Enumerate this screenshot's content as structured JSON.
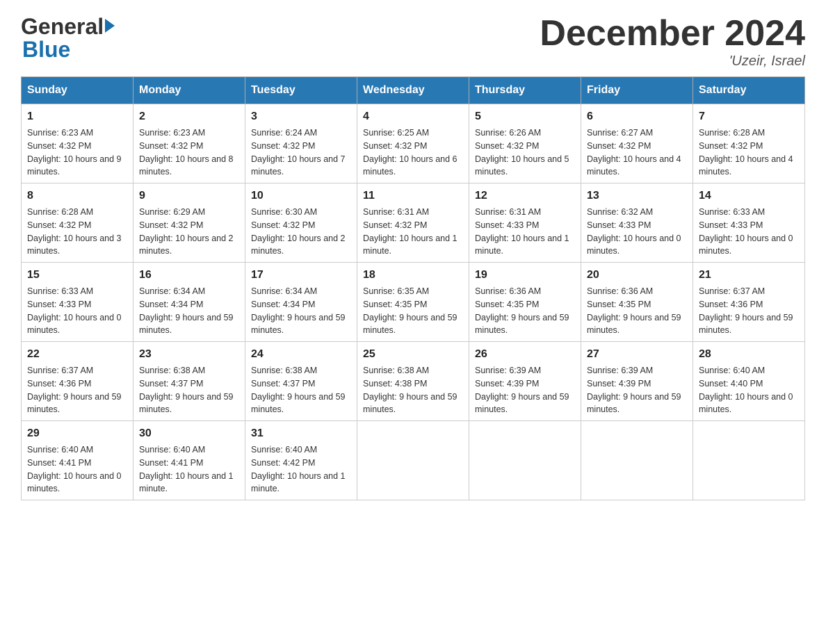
{
  "header": {
    "logo_line1": "General",
    "logo_line2": "Blue",
    "month_title": "December 2024",
    "location": "'Uzeir, Israel"
  },
  "weekdays": [
    "Sunday",
    "Monday",
    "Tuesday",
    "Wednesday",
    "Thursday",
    "Friday",
    "Saturday"
  ],
  "weeks": [
    [
      {
        "day": "1",
        "sunrise": "6:23 AM",
        "sunset": "4:32 PM",
        "daylight": "10 hours and 9 minutes."
      },
      {
        "day": "2",
        "sunrise": "6:23 AM",
        "sunset": "4:32 PM",
        "daylight": "10 hours and 8 minutes."
      },
      {
        "day": "3",
        "sunrise": "6:24 AM",
        "sunset": "4:32 PM",
        "daylight": "10 hours and 7 minutes."
      },
      {
        "day": "4",
        "sunrise": "6:25 AM",
        "sunset": "4:32 PM",
        "daylight": "10 hours and 6 minutes."
      },
      {
        "day": "5",
        "sunrise": "6:26 AM",
        "sunset": "4:32 PM",
        "daylight": "10 hours and 5 minutes."
      },
      {
        "day": "6",
        "sunrise": "6:27 AM",
        "sunset": "4:32 PM",
        "daylight": "10 hours and 4 minutes."
      },
      {
        "day": "7",
        "sunrise": "6:28 AM",
        "sunset": "4:32 PM",
        "daylight": "10 hours and 4 minutes."
      }
    ],
    [
      {
        "day": "8",
        "sunrise": "6:28 AM",
        "sunset": "4:32 PM",
        "daylight": "10 hours and 3 minutes."
      },
      {
        "day": "9",
        "sunrise": "6:29 AM",
        "sunset": "4:32 PM",
        "daylight": "10 hours and 2 minutes."
      },
      {
        "day": "10",
        "sunrise": "6:30 AM",
        "sunset": "4:32 PM",
        "daylight": "10 hours and 2 minutes."
      },
      {
        "day": "11",
        "sunrise": "6:31 AM",
        "sunset": "4:32 PM",
        "daylight": "10 hours and 1 minute."
      },
      {
        "day": "12",
        "sunrise": "6:31 AM",
        "sunset": "4:33 PM",
        "daylight": "10 hours and 1 minute."
      },
      {
        "day": "13",
        "sunrise": "6:32 AM",
        "sunset": "4:33 PM",
        "daylight": "10 hours and 0 minutes."
      },
      {
        "day": "14",
        "sunrise": "6:33 AM",
        "sunset": "4:33 PM",
        "daylight": "10 hours and 0 minutes."
      }
    ],
    [
      {
        "day": "15",
        "sunrise": "6:33 AM",
        "sunset": "4:33 PM",
        "daylight": "10 hours and 0 minutes."
      },
      {
        "day": "16",
        "sunrise": "6:34 AM",
        "sunset": "4:34 PM",
        "daylight": "9 hours and 59 minutes."
      },
      {
        "day": "17",
        "sunrise": "6:34 AM",
        "sunset": "4:34 PM",
        "daylight": "9 hours and 59 minutes."
      },
      {
        "day": "18",
        "sunrise": "6:35 AM",
        "sunset": "4:35 PM",
        "daylight": "9 hours and 59 minutes."
      },
      {
        "day": "19",
        "sunrise": "6:36 AM",
        "sunset": "4:35 PM",
        "daylight": "9 hours and 59 minutes."
      },
      {
        "day": "20",
        "sunrise": "6:36 AM",
        "sunset": "4:35 PM",
        "daylight": "9 hours and 59 minutes."
      },
      {
        "day": "21",
        "sunrise": "6:37 AM",
        "sunset": "4:36 PM",
        "daylight": "9 hours and 59 minutes."
      }
    ],
    [
      {
        "day": "22",
        "sunrise": "6:37 AM",
        "sunset": "4:36 PM",
        "daylight": "9 hours and 59 minutes."
      },
      {
        "day": "23",
        "sunrise": "6:38 AM",
        "sunset": "4:37 PM",
        "daylight": "9 hours and 59 minutes."
      },
      {
        "day": "24",
        "sunrise": "6:38 AM",
        "sunset": "4:37 PM",
        "daylight": "9 hours and 59 minutes."
      },
      {
        "day": "25",
        "sunrise": "6:38 AM",
        "sunset": "4:38 PM",
        "daylight": "9 hours and 59 minutes."
      },
      {
        "day": "26",
        "sunrise": "6:39 AM",
        "sunset": "4:39 PM",
        "daylight": "9 hours and 59 minutes."
      },
      {
        "day": "27",
        "sunrise": "6:39 AM",
        "sunset": "4:39 PM",
        "daylight": "9 hours and 59 minutes."
      },
      {
        "day": "28",
        "sunrise": "6:40 AM",
        "sunset": "4:40 PM",
        "daylight": "10 hours and 0 minutes."
      }
    ],
    [
      {
        "day": "29",
        "sunrise": "6:40 AM",
        "sunset": "4:41 PM",
        "daylight": "10 hours and 0 minutes."
      },
      {
        "day": "30",
        "sunrise": "6:40 AM",
        "sunset": "4:41 PM",
        "daylight": "10 hours and 1 minute."
      },
      {
        "day": "31",
        "sunrise": "6:40 AM",
        "sunset": "4:42 PM",
        "daylight": "10 hours and 1 minute."
      },
      null,
      null,
      null,
      null
    ]
  ],
  "labels": {
    "sunrise_prefix": "Sunrise: ",
    "sunset_prefix": "Sunset: ",
    "daylight_prefix": "Daylight: "
  }
}
